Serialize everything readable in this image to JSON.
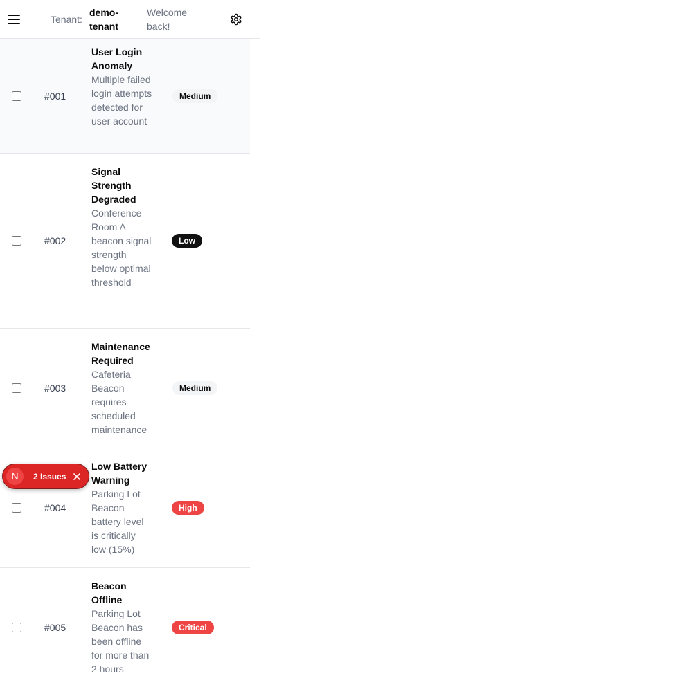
{
  "header": {
    "tenant_label": "Tenant:",
    "tenant_name": "demo-tenant",
    "welcome": "Welcome back!"
  },
  "alerts": [
    {
      "id": "#001",
      "title": "User Login Anomaly",
      "description": "Multiple failed login attempts detected for user account",
      "severity": "Medium"
    },
    {
      "id": "#002",
      "title": "Signal Strength Degraded",
      "description": "Conference Room A beacon signal strength below optimal threshold",
      "severity": "Low"
    },
    {
      "id": "#003",
      "title": "Maintenance Required",
      "description": "Cafeteria Beacon requires scheduled maintenance",
      "severity": "Medium"
    },
    {
      "id": "#004",
      "title": "Low Battery Warning",
      "description": "Parking Lot Beacon battery level is critically low (15%)",
      "severity": "High"
    },
    {
      "id": "#005",
      "title": "Beacon Offline",
      "description": "Parking Lot Beacon has been offline for more than 2 hours",
      "severity": "Critical"
    }
  ],
  "issues_badge": {
    "logo": "N",
    "label": "2 Issues"
  },
  "colors": {
    "critical": "#ef4444",
    "high": "#ef4444",
    "low": "#111111",
    "medium": "#f3f4f6",
    "issues_bg": "#dc2626"
  }
}
